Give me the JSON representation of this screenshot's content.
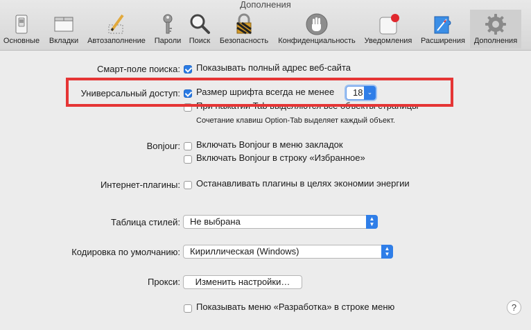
{
  "window": {
    "title": "Дополнения"
  },
  "tabs": [
    {
      "label": "Основные",
      "icon": "general-switch-icon"
    },
    {
      "label": "Вкладки",
      "icon": "tabs-window-icon"
    },
    {
      "label": "Автозаполнение",
      "icon": "pencil-icon"
    },
    {
      "label": "Пароли",
      "icon": "key-icon"
    },
    {
      "label": "Поиск",
      "icon": "magnifier-icon"
    },
    {
      "label": "Безопасность",
      "icon": "padlock-icon"
    },
    {
      "label": "Конфиденциальность",
      "icon": "hand-icon"
    },
    {
      "label": "Уведомления",
      "icon": "notification-badge-icon"
    },
    {
      "label": "Расширения",
      "icon": "puzzle-compass-icon"
    },
    {
      "label": "Дополнения",
      "icon": "gear-icon",
      "active": true
    }
  ],
  "settings": {
    "smart_search": {
      "label": "Смарт-поле поиска:",
      "option": "Показывать полный адрес веб-сайта",
      "checked": true
    },
    "accessibility": {
      "label": "Универсальный доступ:",
      "font_option": "Размер шрифта всегда не менее",
      "font_size": "18",
      "font_checked": true,
      "tab_option": "При нажатии Tab выделяются все объекты страницы",
      "tab_checked": false,
      "tab_note": "Сочетание клавиш Option-Tab выделяет каждый объект."
    },
    "bonjour": {
      "label": "Bonjour:",
      "option1": "Включать Bonjour в меню закладок",
      "option2": "Включать Bonjour в строку «Избранное»"
    },
    "plugins": {
      "label": "Интернет-плагины:",
      "option": "Останавливать плагины в целях экономии энергии"
    },
    "stylesheet": {
      "label": "Таблица стилей:",
      "value": "Не выбрана"
    },
    "encoding": {
      "label": "Кодировка по умолчанию:",
      "value": "Кириллическая (Windows)"
    },
    "proxy": {
      "label": "Прокси:",
      "button": "Изменить настройки…"
    },
    "develop": {
      "option": "Показывать меню «Разработка» в строке меню"
    }
  },
  "help": {
    "label": "?"
  },
  "colors": {
    "highlight": "#e53535",
    "accent": "#2f7ee8"
  }
}
